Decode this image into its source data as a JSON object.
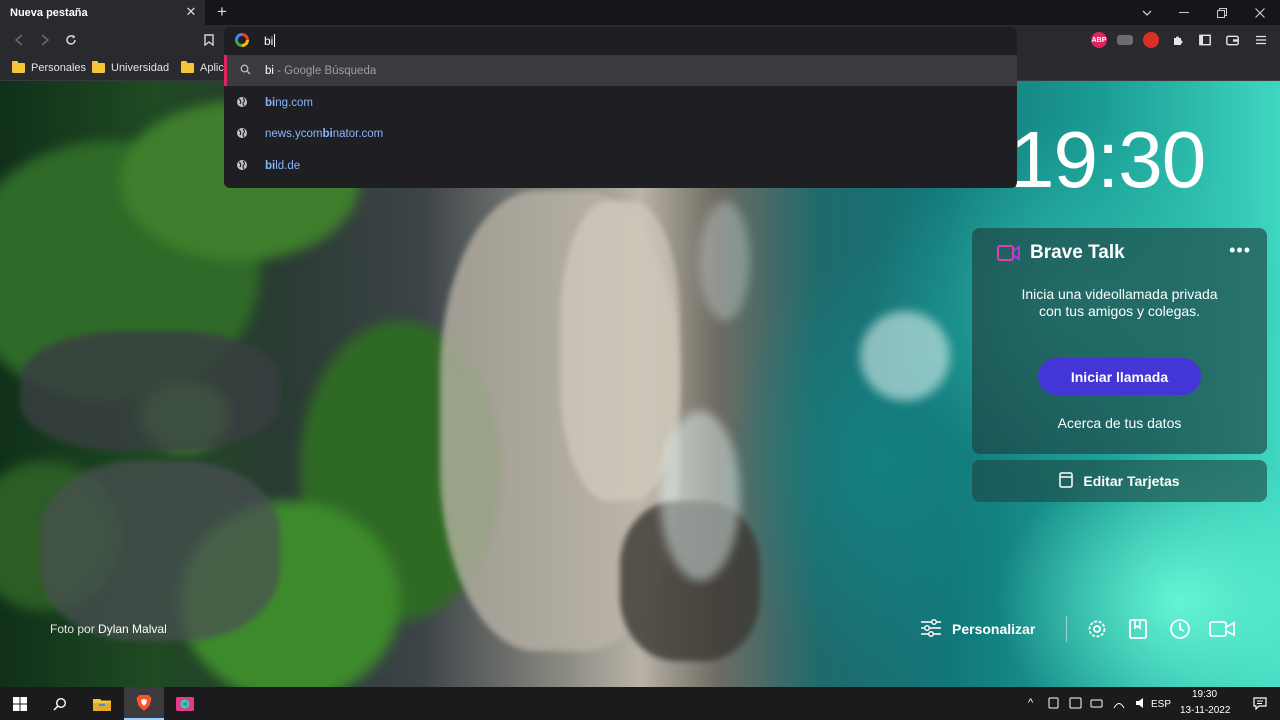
{
  "browser": {
    "tab_title": "Nueva pestaña",
    "tab_close_icon": "close-icon",
    "new_tab_icon": "plus-icon",
    "window_controls": [
      "chevron-down-icon",
      "minimize-icon",
      "restore-icon",
      "close-icon"
    ]
  },
  "toolbar": {
    "back_icon": "back-icon",
    "forward_icon": "forward-icon",
    "reload_icon": "reload-icon",
    "bookmark_icon": "bookmark-icon",
    "extensions": [
      {
        "name": "adblock-icon",
        "label": "ABP",
        "color": "#e0245e"
      },
      {
        "name": "extension-gray-icon",
        "label": "",
        "color": "#6b6b70"
      },
      {
        "name": "extension-red-icon",
        "label": "",
        "color": "#d93025"
      }
    ],
    "right_icons": [
      "puzzle-icon",
      "sidebar-icon",
      "wallet-icon",
      "menu-icon"
    ]
  },
  "bookmarks": [
    {
      "label": "Personales"
    },
    {
      "label": "Universidad"
    },
    {
      "label": "Aplic"
    }
  ],
  "omnibox": {
    "value": "bi",
    "engine_icon": "google-icon"
  },
  "suggestions": [
    {
      "type": "search",
      "match": "bi",
      "rest": "",
      "suffix": " - Google Búsqueda",
      "selected": true
    },
    {
      "type": "url",
      "pre": "",
      "match": "bi",
      "rest": "ng.com"
    },
    {
      "type": "url",
      "pre": "news.ycom",
      "match": "bi",
      "rest": "nator.com"
    },
    {
      "type": "url",
      "pre": "",
      "match": "bi",
      "rest": "ld.de"
    }
  ],
  "clock": "19:30",
  "brave_talk": {
    "title": "Brave Talk",
    "more": "•••",
    "description": "Inicia una videollamada privada con tus amigos y colegas.",
    "cta": "Iniciar llamada",
    "link": "Acerca de tus datos",
    "accent": "#4436d6"
  },
  "edit_cards": "Editar Tarjetas",
  "photo_credit": {
    "prefix": "Foto por",
    "author": "Dylan Malval"
  },
  "customize": "Personalizar",
  "bottom_icons": [
    "settings-icon",
    "bookmarks-icon",
    "history-icon",
    "brave-talk-icon"
  ],
  "taskbar": {
    "apps": [
      "windows-start-icon",
      "search-icon",
      "file-explorer-icon",
      "brave-browser-icon",
      "app-icon"
    ],
    "language": "ESP",
    "time": "19:30",
    "date": "13-11-2022"
  }
}
